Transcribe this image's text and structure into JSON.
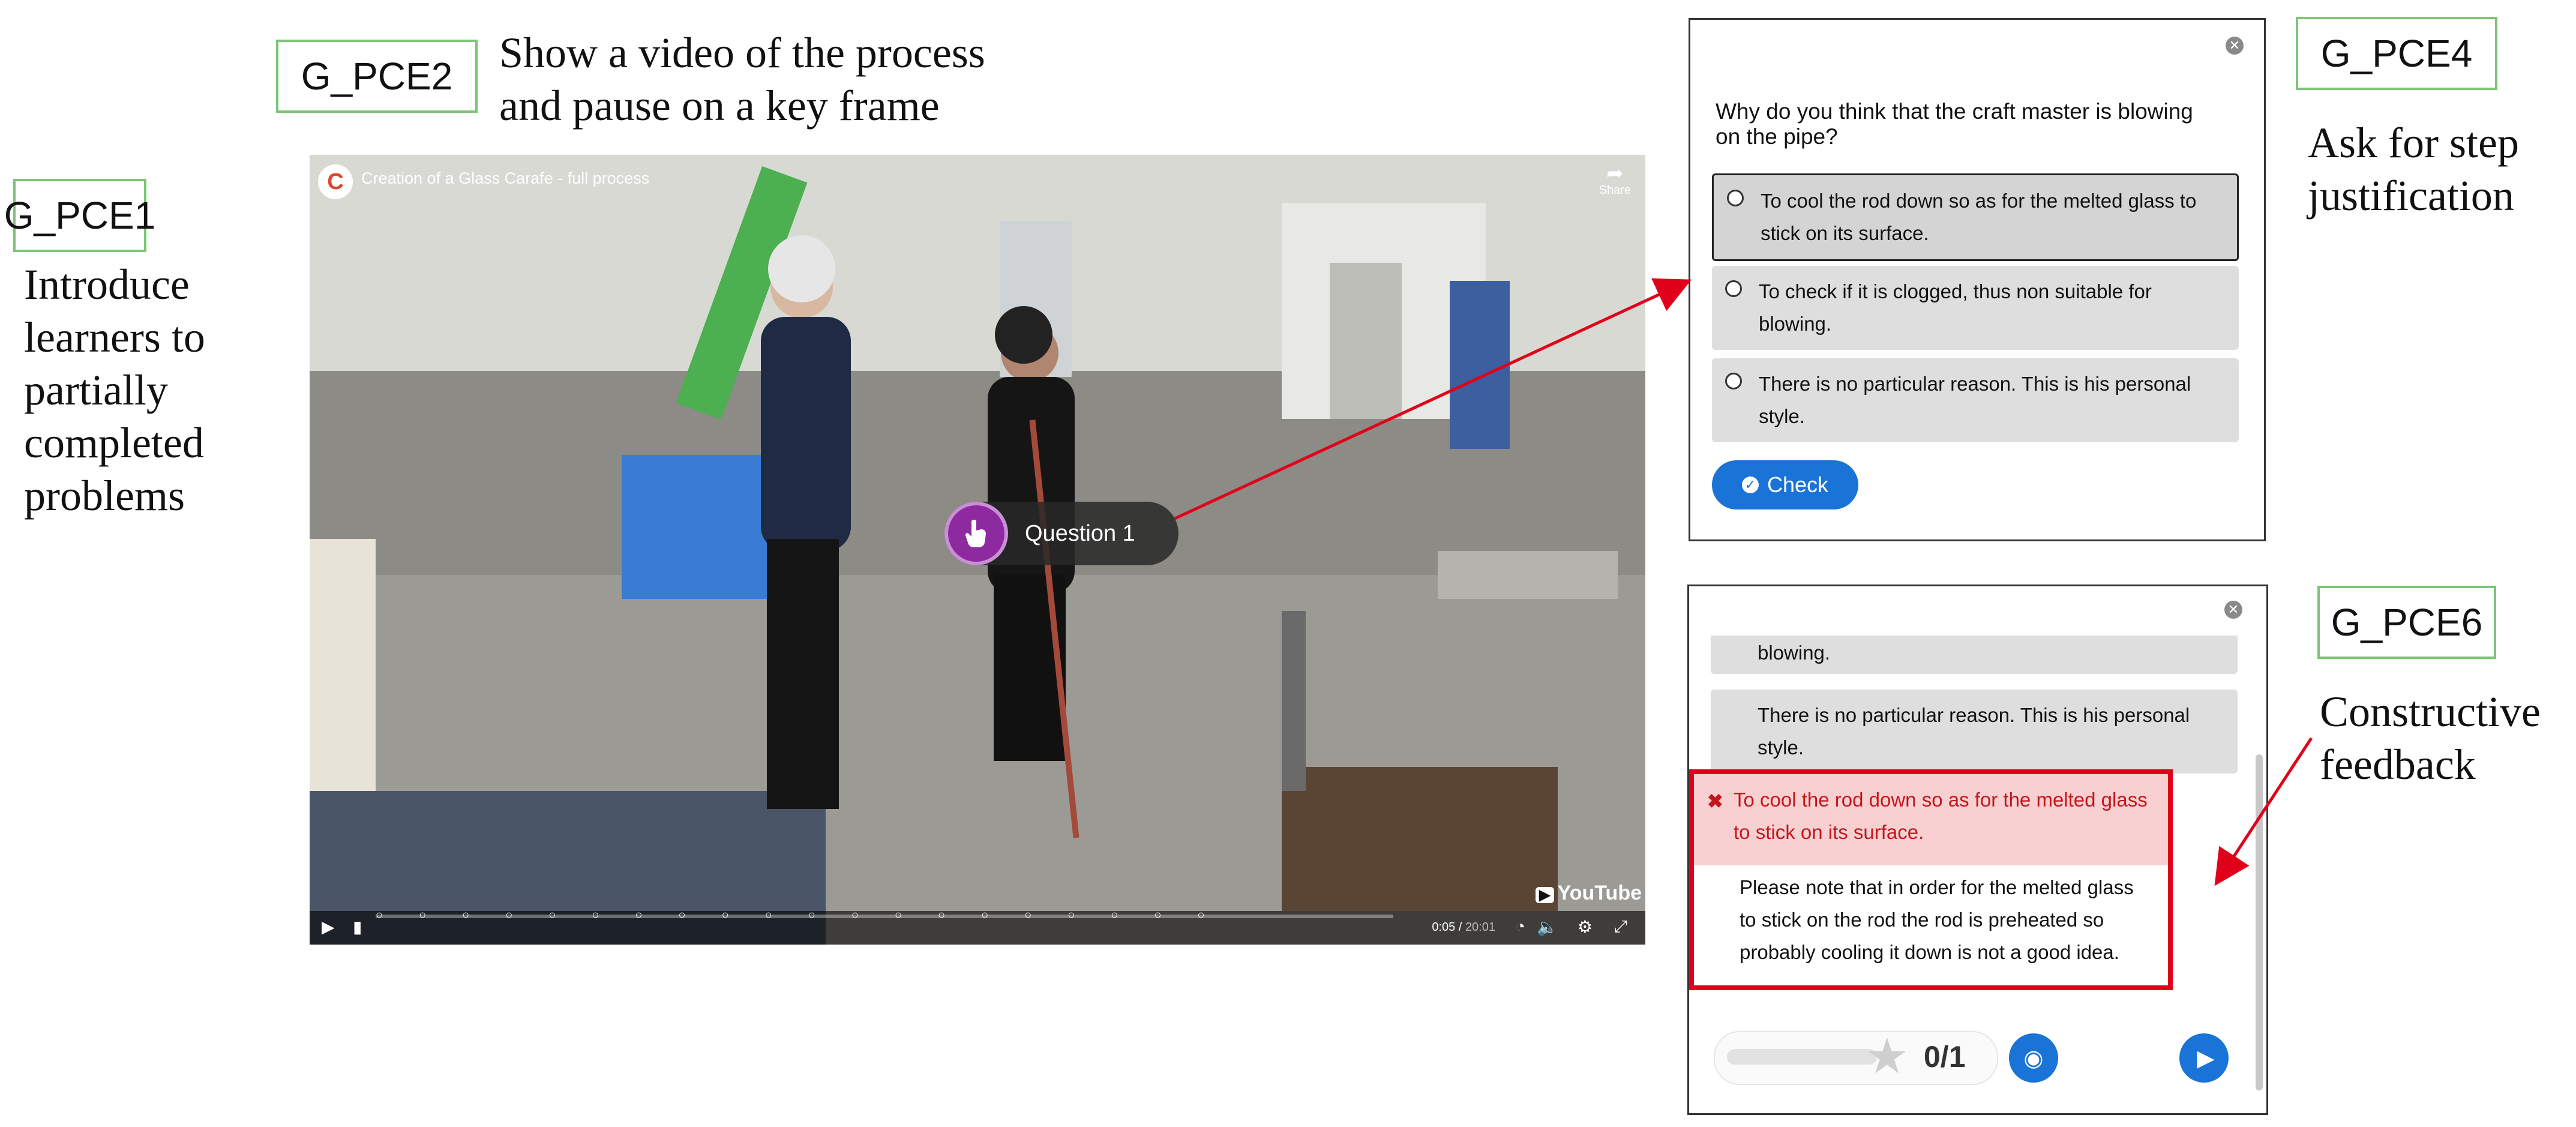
{
  "labels": {
    "g1": "G_PCE1",
    "g2": "G_PCE2",
    "g4": "G_PCE4",
    "g6": "G_PCE6"
  },
  "annotations": {
    "g1_lines": [
      "Introduce",
      "learners to",
      "partially",
      "completed",
      "problems"
    ],
    "g2_lines": [
      "Show a video of the process",
      "and pause on a key frame"
    ],
    "g4_lines": [
      "Ask for step",
      "justification"
    ],
    "g6_lines": [
      "Constructive",
      "feedback"
    ]
  },
  "video": {
    "title": "Creation of a Glass Carafe - full process",
    "share_label": "Share",
    "question_marker": "Question 1",
    "time_current": "0:05",
    "time_total": "20:01",
    "time_separator": "/",
    "brand": "YouTube"
  },
  "question_panel": {
    "question": "Why do you think that the craft master is blowing on the pipe?",
    "options": [
      "To cool the rod down so as for the melted glass to stick on its surface.",
      "To check if it is clogged, thus non suitable for blowing.",
      "There is no particular reason. This is his personal style."
    ],
    "check_label": "Check"
  },
  "feedback_panel": {
    "partial_option": "blowing.",
    "option_3": "There is no particular reason. This is his personal style.",
    "wrong_answer": "To cool the rod down so as for the melted glass to stick on its surface.",
    "feedback": "Please note that in order for the melted glass to stick on the rod the rod is preheated so probably cooling it down is not a good idea.",
    "score": "0/1"
  },
  "colors": {
    "label_border": "#7cc576",
    "accent_blue": "#1a73d6",
    "error_red": "#e1001a",
    "marker_purple": "#8e2a9f"
  }
}
